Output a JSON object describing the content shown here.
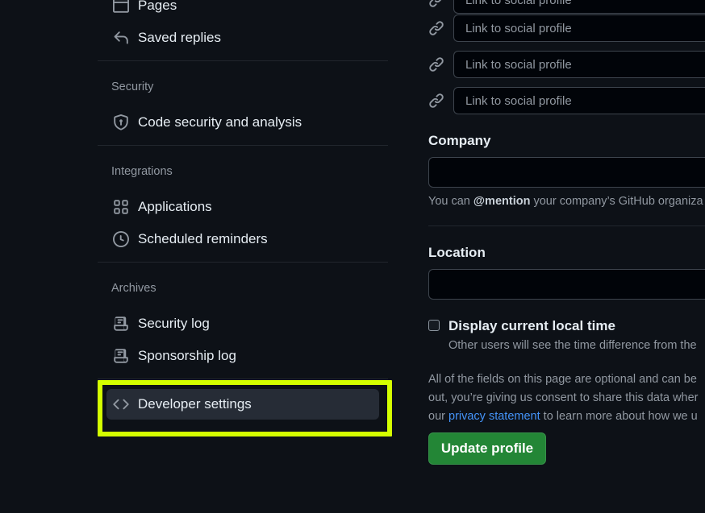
{
  "sidebar": {
    "items_top": [
      {
        "label": "Pages",
        "icon": "browser-icon"
      },
      {
        "label": "Saved replies",
        "icon": "reply-icon"
      }
    ],
    "sections": [
      {
        "label": "Security",
        "items": [
          {
            "label": "Code security and analysis",
            "icon": "shield-lock-icon"
          }
        ]
      },
      {
        "label": "Integrations",
        "items": [
          {
            "label": "Applications",
            "icon": "apps-icon"
          },
          {
            "label": "Scheduled reminders",
            "icon": "clock-icon"
          }
        ]
      },
      {
        "label": "Archives",
        "items": [
          {
            "label": "Security log",
            "icon": "log-icon"
          },
          {
            "label": "Sponsorship log",
            "icon": "log-icon"
          }
        ]
      }
    ],
    "developer": {
      "label": "Developer settings",
      "icon": "code-icon"
    },
    "highlight_color": "#d4ff00"
  },
  "profile": {
    "social_placeholder": "Link to social profile",
    "company": {
      "label": "Company",
      "value": "",
      "note_prefix": "You can ",
      "note_bold": "@mention",
      "note_suffix": " your company’s GitHub organiza"
    },
    "location": {
      "label": "Location",
      "value": ""
    },
    "local_time": {
      "label": "Display current local time",
      "note": "Other users will see the time difference from the",
      "checked": false
    },
    "disclaimer": {
      "line1": "All of the fields on this page are optional and can be",
      "line2": "out, you’re giving us consent to share this data wher",
      "line3_prefix": "our ",
      "link": "privacy statement",
      "line3_suffix": " to learn more about how we u"
    },
    "submit_label": "Update profile"
  },
  "colors": {
    "background": "#0d1117",
    "accent_button": "#238636",
    "link": "#4493f8"
  }
}
